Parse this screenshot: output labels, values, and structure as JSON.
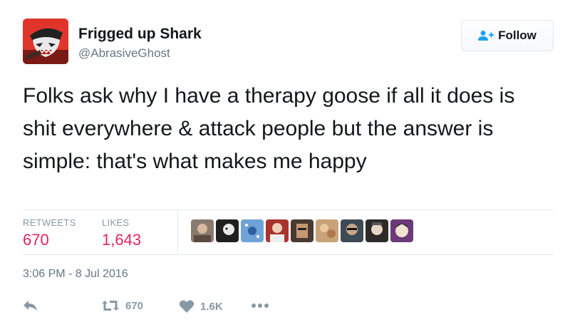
{
  "user": {
    "display_name": "Frigged up Shark",
    "handle": "@AbrasiveGhost",
    "avatar_icon": "shark-avatar"
  },
  "follow_button": {
    "label": "Follow",
    "icon": "add-user-icon"
  },
  "tweet": {
    "text": "Folks ask why I have a therapy goose if all it does is shit everywhere & attack people but the answer is simple: that's what makes me happy"
  },
  "stats": {
    "retweets_label": "RETWEETS",
    "retweets_value": "670",
    "likes_label": "LIKES",
    "likes_value": "1,643"
  },
  "likers": [
    {
      "icon": "liker-avatar-1",
      "color": "#8a7a6e"
    },
    {
      "icon": "liker-avatar-2",
      "color": "#1f1f1f"
    },
    {
      "icon": "liker-avatar-3",
      "color": "#6fa3d8"
    },
    {
      "icon": "liker-avatar-4",
      "color": "#a8332e"
    },
    {
      "icon": "liker-avatar-5",
      "color": "#4b3a2f"
    },
    {
      "icon": "liker-avatar-6",
      "color": "#c9a27a"
    },
    {
      "icon": "liker-avatar-7",
      "color": "#3e4a55"
    },
    {
      "icon": "liker-avatar-8",
      "color": "#2d2a28"
    },
    {
      "icon": "liker-avatar-9",
      "color": "#6b3a7a"
    }
  ],
  "timestamp": "3:06 PM - 8 Jul 2016",
  "actions": {
    "reply_icon": "reply-icon",
    "retweet_icon": "retweet-icon",
    "retweet_count": "670",
    "like_icon": "heart-icon",
    "like_count": "1.6K",
    "more_icon": "more-icon"
  },
  "colors": {
    "accent_red": "#e0245e",
    "follow_blue": "#1da1f2",
    "muted": "#8899a6"
  }
}
